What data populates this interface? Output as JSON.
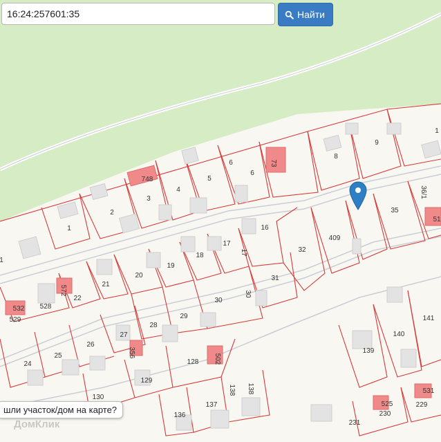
{
  "search": {
    "value": "16:24:257601:35",
    "button_label": "Найти"
  },
  "map": {
    "colors": {
      "forest": "#d6ecc4",
      "ground": "#f8f7f1",
      "plot_border": "#d63a3a",
      "road": "#c9cdd6",
      "building": "#e3e3e3",
      "building_red": "#f08a8a",
      "marker": "#2f7fc4"
    },
    "plots": [
      {
        "label": "1"
      },
      {
        "label": "2"
      },
      {
        "label": "3"
      },
      {
        "label": "4"
      },
      {
        "label": "5"
      },
      {
        "label": "6"
      },
      {
        "label": "6"
      },
      {
        "label": "73"
      },
      {
        "label": "8"
      },
      {
        "label": "9"
      },
      {
        "label": "1"
      },
      {
        "label": "748"
      },
      {
        "label": "16"
      },
      {
        "label": "17"
      },
      {
        "label": "17"
      },
      {
        "label": "18"
      },
      {
        "label": "19"
      },
      {
        "label": "20"
      },
      {
        "label": "21"
      },
      {
        "label": "22"
      },
      {
        "label": "572"
      },
      {
        "label": "528"
      },
      {
        "label": "532"
      },
      {
        "label": "529"
      },
      {
        "label": "32"
      },
      {
        "label": "409"
      },
      {
        "label": "35"
      },
      {
        "label": "36/1"
      },
      {
        "label": "51"
      },
      {
        "label": "31"
      },
      {
        "label": "30"
      },
      {
        "label": "30"
      },
      {
        "label": "29"
      },
      {
        "label": "28"
      },
      {
        "label": "27"
      },
      {
        "label": "356"
      },
      {
        "label": "26"
      },
      {
        "label": "25"
      },
      {
        "label": "24"
      },
      {
        "label": "128"
      },
      {
        "label": "502"
      },
      {
        "label": "138"
      },
      {
        "label": "138"
      },
      {
        "label": "129"
      },
      {
        "label": "130"
      },
      {
        "label": "137"
      },
      {
        "label": "136"
      },
      {
        "label": "139"
      },
      {
        "label": "140"
      },
      {
        "label": "141"
      },
      {
        "label": "525"
      },
      {
        "label": "230"
      },
      {
        "label": "229"
      },
      {
        "label": "531"
      },
      {
        "label": "231"
      },
      {
        "label": "1"
      }
    ]
  },
  "marker": {
    "icon": "map-pin-icon"
  },
  "tooltip": {
    "text": "шли участок/дом на карте?"
  },
  "watermark": {
    "text": "ДомКлик"
  }
}
